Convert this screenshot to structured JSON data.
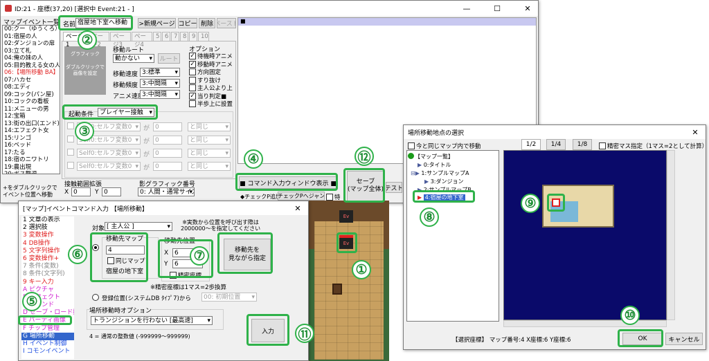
{
  "main": {
    "title": "ID:21 - 座標(37,20) [選択中 Event:21 - ]",
    "event_list_header": "マップイベント一覧",
    "event_list": [
      "00:クー（ゆうくろ）",
      "01:宿屋の人",
      "02:ダンジョンの扉",
      "03:立て札",
      "04:俺の妹の人",
      "05:目的教える女の人",
      "06:【場所移動 BA】",
      "07:ハカセ",
      "08:エディ",
      "09:コック(パン屋)",
      "10:コックの看板",
      "11:メニューの男",
      "12:宝箱",
      "13:街の出口(エンド)",
      "14:エフェクト女",
      "15:リンゴ",
      "16:ベッド",
      "17:たる",
      "18:宿のニワトリ",
      "19:農出現",
      "20:ボス撃退",
      "21:宿屋地下室へ移動"
    ],
    "list_hint": "+をダブルクリックで\nイベント位置へ移動",
    "name_label": "名前",
    "name_value": "宿屋地下室へ移動",
    "new_page": ">新規ページ",
    "copy": "コピー",
    "delete": "削除",
    "paste": "ペースト",
    "tabs": [
      "ページ1",
      "ページ2",
      "ページ3",
      "ページ4",
      "5",
      "6",
      "7",
      "8",
      "9",
      "10"
    ],
    "graphic_title": "グラフィック",
    "graphic_hint": "ダブルクリックで\n画像を設定",
    "route_label": "移動ルート",
    "route_value": "動かない",
    "route_button": "ルート",
    "speed_label": "移動速度",
    "speed_value": "3:標準",
    "freq_label": "移動頻度",
    "freq_value": "3:中間隔",
    "anim_label": "アニメ速度",
    "anim_value": "3:中間隔",
    "options_label": "オプション",
    "options": [
      {
        "label": "待機時アニメ",
        "checked": true
      },
      {
        "label": "移動時アニメ",
        "checked": true
      },
      {
        "label": "方向固定",
        "checked": false
      },
      {
        "label": "すり抜け",
        "checked": false
      },
      {
        "label": "主人公より上",
        "checked": false
      },
      {
        "label": "当り判定■",
        "checked": true
      },
      {
        "label": "半歩上に設置",
        "checked": false
      }
    ],
    "trigger_label": "起動条件",
    "trigger_value": "プレイヤー接触",
    "conditions": [
      {
        "var": "Self0:セルフ変数0",
        "ga": "が",
        "val": "0",
        "cmp": "と同じ"
      },
      {
        "var": "Self0:セルフ変数0",
        "ga": "が",
        "val": "0",
        "cmp": "と同じ"
      },
      {
        "var": "Self0:セルフ変数0",
        "ga": "が",
        "val": "0",
        "cmp": "と同じ"
      },
      {
        "var": "Self0:セルフ変数0",
        "ga": "が",
        "val": "0",
        "cmp": "と同じ"
      }
    ],
    "contact_label": "接触範囲拡張",
    "x_label": "X",
    "x_value": "0",
    "y_label": "Y",
    "y_value": "0",
    "shadow_label": "影グラフィック番号",
    "shadow_value": "0: 人間・通常サイズ",
    "cmd_window_button": "■ コマンド入力ウィンドウ表示 ■",
    "save_button": "セーブ\n(マップ全体)",
    "test_button": "テスト",
    "check_row": "◆チェックP追加",
    "next_check": "次チェックPへジャンプ",
    "special": "特",
    "script_marker": "■"
  },
  "cmd": {
    "title": "[マップ]イベントコマンド入力 【場所移動】",
    "commands": [
      {
        "label": "1 文章の表示",
        "color": "#000000"
      },
      {
        "label": "2 選択肢",
        "color": "#000000"
      },
      {
        "label": "3 変数操作",
        "color": "#e02020"
      },
      {
        "label": "4 DB操作",
        "color": "#e02020"
      },
      {
        "label": "5 文字列操作",
        "color": "#e02020"
      },
      {
        "label": "6 変数操作+",
        "color": "#e02020"
      },
      {
        "label": "7 条件(変数)",
        "color": "#888888"
      },
      {
        "label": "8 条件(文字列)",
        "color": "#888888"
      },
      {
        "label": "9 キー入力",
        "color": "#e02020"
      },
      {
        "label": "A ピクチャ",
        "color": "#d020d0"
      },
      {
        "label": "B エフェクト",
        "color": "#d020d0"
      },
      {
        "label": "C サウンド",
        "color": "#d020d0"
      },
      {
        "label": "D セーブ・ロード操作",
        "color": "#d020d0"
      },
      {
        "label": "E パーティ画像",
        "color": "#d020d0"
      },
      {
        "label": "F チップ管理",
        "color": "#d020d0"
      },
      {
        "label": "G 場所移動",
        "color": "#000000"
      },
      {
        "label": "H イベント制御",
        "color": "#2050e0"
      },
      {
        "label": "I コモンイベント",
        "color": "#2050e0"
      }
    ],
    "target_label": "対象",
    "target_value": "[ 主人公 ]",
    "note": "※実数から位置を呼び出す際は\n2000000～を指定してください",
    "dest_map_label": "移動先マップ",
    "dest_map_value": "4",
    "same_map": "同じマップ",
    "map_name": "宿屋の地下室",
    "dest_pos_label": "移動先位置",
    "x_label": "X",
    "x_value": "6",
    "y_label": "Y",
    "y_value": "6",
    "precise": "精密座標",
    "view_button": "移動先を\n見ながら指定",
    "precise_note": "※精密座標は1マス=2歩換算",
    "reg_label": "登録位置(システムDB ﾀｲﾌﾟ7)から",
    "reg_value": "00: 初期位置",
    "trans_label": "場所移動時オプション",
    "trans_value": "トランジションを行わない [最高速]",
    "input_button": "入力",
    "footer": "4 = 通常の整数値 (-999999～999999)"
  },
  "dest": {
    "title": "場所移動地点の選択",
    "same_map": "今と同じマップ内で移動",
    "zoom": [
      "1/2",
      "1/4",
      "1/8"
    ],
    "precise": "精密マス指定（1マス=2として計算）",
    "tree": [
      "【マップ一覧】",
      "0:タイトル",
      "1:サンプルマップA",
      "3:ダンジョン",
      "2:サンプルマップB",
      "4:宿屋の地下室"
    ],
    "status": "【選択座標】 マップ番号:4 X座標:6 Y座標:6",
    "ok": "OK",
    "cancel": "キャンセル"
  },
  "markers": [
    "①",
    "②",
    "③",
    "④",
    "⑤",
    "⑥",
    "⑦",
    "⑧",
    "⑨",
    "⑩",
    "⑪",
    "⑫"
  ]
}
